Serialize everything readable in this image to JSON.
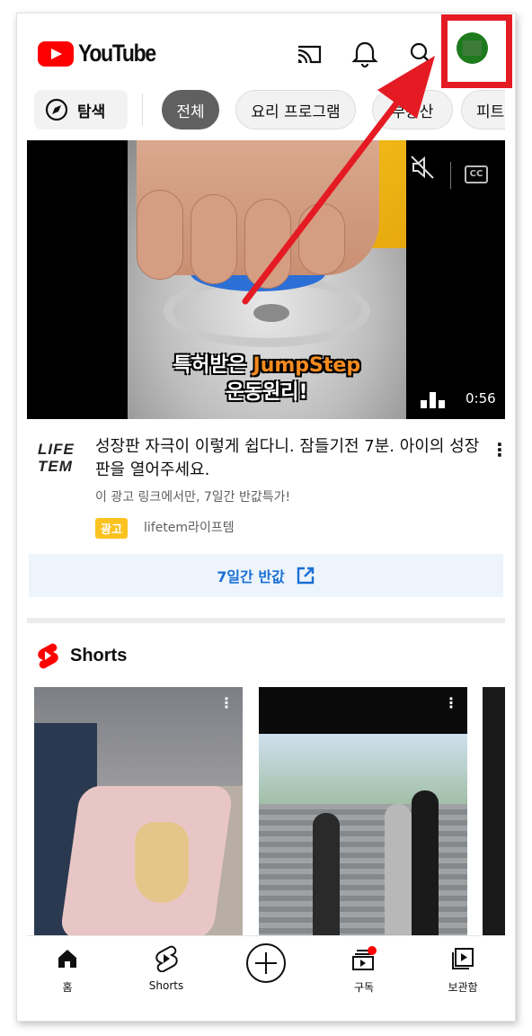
{
  "header": {
    "logo_text": "YouTube",
    "icons": [
      "cast-icon",
      "bell-icon",
      "search-icon",
      "avatar"
    ]
  },
  "chips": {
    "explore_label": "탐색",
    "items": [
      "전체",
      "요리 프로그램",
      "부동산",
      "피트"
    ],
    "active_index": 0
  },
  "video": {
    "caption_line1_white": "특허받은 ",
    "caption_line1_orange": "JumpStep",
    "caption_line2": "운동원리!",
    "duration": "0:56",
    "muted": true,
    "cc_label": "CC"
  },
  "ad": {
    "logo_line1": "LIFE",
    "logo_line2": "TEM",
    "title": "성장판 자극이 이렇게 쉽다니. 잠들기전 7분. 아이의 성장판을 열어주세요.",
    "subtitle": "이 광고 링크에서만, 7일간 반값특가!",
    "badge": "광고",
    "channel": "lifetem라이프템",
    "cta_label": "7일간 반값"
  },
  "shorts": {
    "title": "Shorts"
  },
  "bottom_nav": {
    "items": [
      {
        "label": "홈",
        "icon": "home-icon"
      },
      {
        "label": "Shorts",
        "icon": "shorts-icon"
      },
      {
        "label": "",
        "icon": "create-icon"
      },
      {
        "label": "구독",
        "icon": "subscriptions-icon"
      },
      {
        "label": "보관함",
        "icon": "library-icon"
      }
    ]
  },
  "colors": {
    "brand_red": "#ff0000",
    "annotation_red": "#e51b24",
    "ad_badge": "#fcc220",
    "cta_blue": "#1a6fd4"
  }
}
